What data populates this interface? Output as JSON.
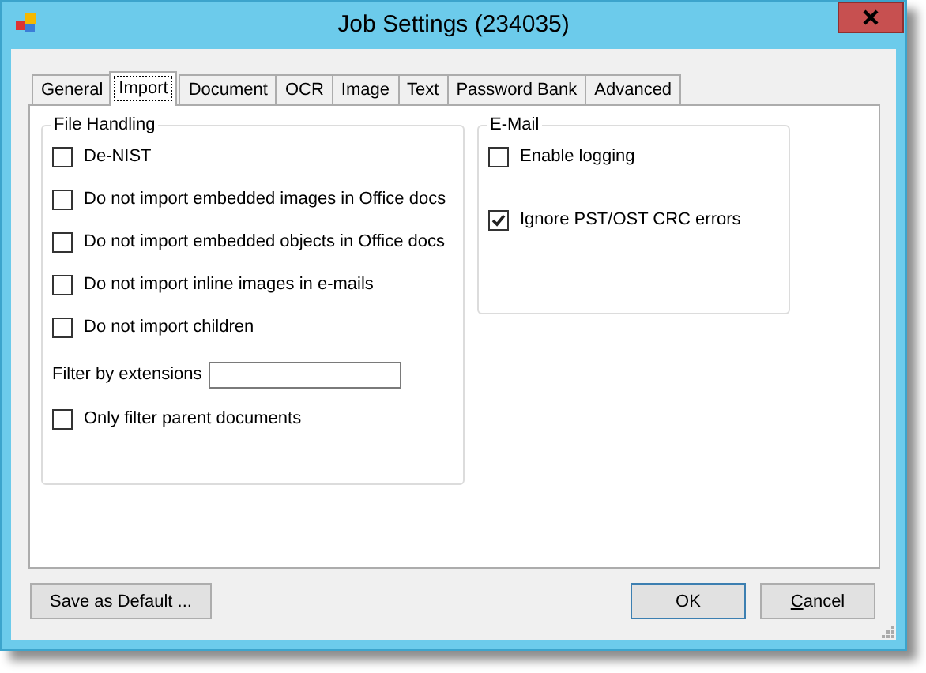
{
  "window": {
    "title": "Job Settings (234035)"
  },
  "tabs": [
    {
      "label": "General",
      "selected": false
    },
    {
      "label": "Import",
      "selected": true
    },
    {
      "label": "Document",
      "selected": false
    },
    {
      "label": "OCR",
      "selected": false
    },
    {
      "label": "Image",
      "selected": false
    },
    {
      "label": "Text",
      "selected": false
    },
    {
      "label": "Password Bank",
      "selected": false
    },
    {
      "label": "Advanced",
      "selected": false
    }
  ],
  "file_handling": {
    "title": "File Handling",
    "items": [
      {
        "kind": "checkbox",
        "label": "De-NIST",
        "checked": false
      },
      {
        "kind": "checkbox",
        "label": "Do not import embedded images in Office docs",
        "checked": false
      },
      {
        "kind": "checkbox",
        "label": "Do not import embedded objects in Office docs",
        "checked": false
      },
      {
        "kind": "checkbox",
        "label": "Do not import inline images in e-mails",
        "checked": false
      },
      {
        "kind": "checkbox",
        "label": "Do not import children",
        "checked": false
      },
      {
        "kind": "field",
        "label": "Filter by extensions"
      },
      {
        "kind": "checkbox",
        "label": "Only filter parent documents",
        "checked": false
      }
    ]
  },
  "email": {
    "title": "E-Mail",
    "items": [
      {
        "kind": "checkbox",
        "label": "Enable logging",
        "checked": false
      },
      {
        "kind": "checkbox",
        "label": "Ignore PST/OST CRC errors",
        "checked": true
      }
    ]
  },
  "buttons": {
    "left": [
      "Save as Default ..."
    ],
    "right": [
      "OK",
      "Cancel"
    ]
  }
}
